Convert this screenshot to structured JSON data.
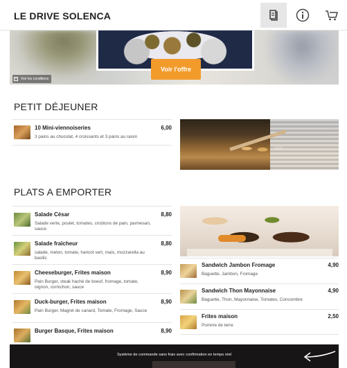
{
  "header": {
    "brand": "LE DRIVE SOLENCA",
    "menu_icon": "book-menu-icon",
    "info_icon": "info-icon",
    "cart_icon": "cart-icon"
  },
  "banner": {
    "offer_label": "Voir l'offre",
    "conditions_label": "Voir les conditions",
    "offer_color": "#f29b2b"
  },
  "sections": [
    {
      "title": "PETIT DÉJEUNER",
      "items": [
        {
          "name": "10 Mini-viennoiseries",
          "price": "6,00",
          "desc": "3 pains au chocolat, 4 croissants et 3 pains au raisin"
        }
      ]
    },
    {
      "title": "PLATS A EMPORTER",
      "items": [
        {
          "name": "Salade César",
          "price": "8,80",
          "desc": "Salade verte, poulet, tomates, croûtons de pain, parmesan, sauce"
        },
        {
          "name": "Salade fraîcheur",
          "price": "8,80",
          "desc": "salade, melon, tomate, haricot vert, maïs, mozzarella au basilic"
        },
        {
          "name": "Cheeseburger, Frites maison",
          "price": "8,90",
          "desc": "Pain Burger, steak haché de boeuf, fromage, tomate, oignon, cornichon, sauce"
        },
        {
          "name": "Duck-burger, Frites maison",
          "price": "8,90",
          "desc": "Pain Burger, Magret de canard, Tomate, Fromage, Sauce"
        },
        {
          "name": "Burger Basque, Frites maison",
          "price": "8,90",
          "desc": ""
        }
      ],
      "right_items": [
        {
          "name": "Sandwich Jambon Fromage",
          "price": "4,90",
          "desc": "Baguette, Jambon, Fromage"
        },
        {
          "name": "Sandwich Thon Mayonnaise",
          "price": "4,90",
          "desc": "Baguette, Thon, Mayonnaise, Tomates, Concombre"
        },
        {
          "name": "Frites maison",
          "price": "2,50",
          "desc": "Pomme de terre"
        }
      ]
    }
  ],
  "footer": {
    "message": "Système de commande sans frais avec confirmation en temps réel",
    "arrow_icon": "arrow-left-icon"
  }
}
